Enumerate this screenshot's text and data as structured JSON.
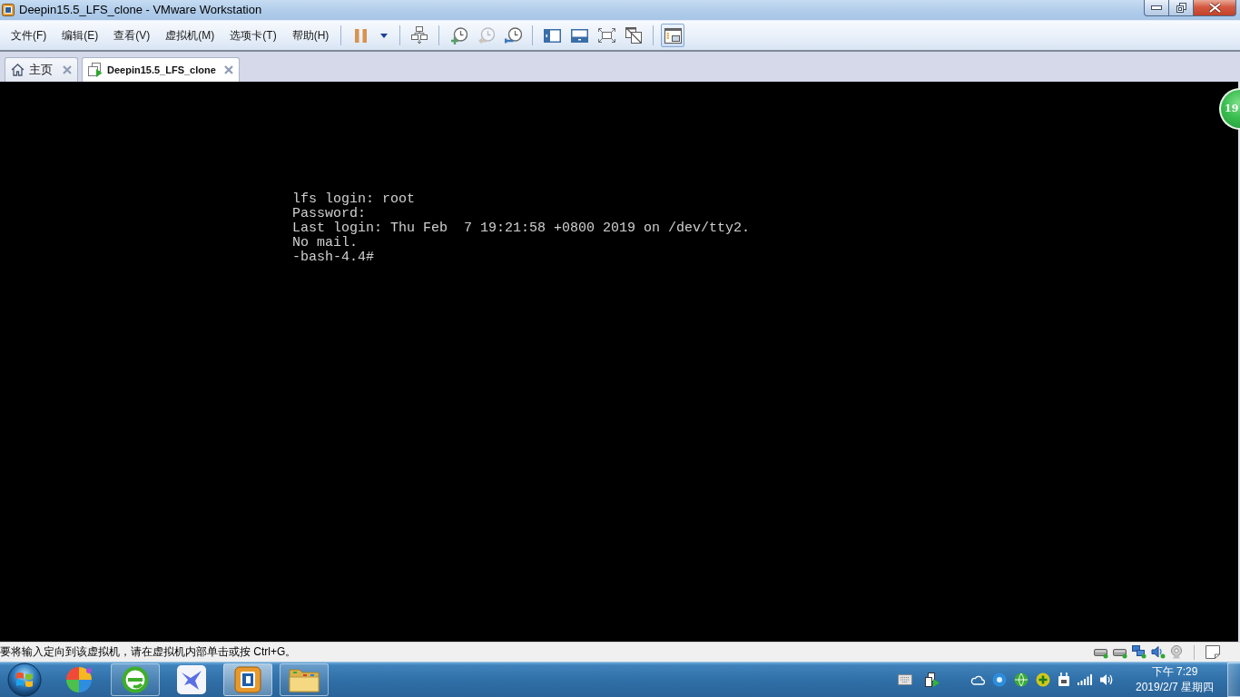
{
  "window": {
    "title": "Deepin15.5_LFS_clone - VMware Workstation"
  },
  "menu": [
    "文件(F)",
    "编辑(E)",
    "查看(V)",
    "虚拟机(M)",
    "选项卡(T)",
    "帮助(H)"
  ],
  "toolbar": {
    "groups": [
      [
        {
          "kind": "pause",
          "disabled": false,
          "selected": false
        },
        {
          "kind": "dropdown",
          "disabled": false,
          "selected": false
        }
      ],
      [
        {
          "kind": "send-keys",
          "disabled": false,
          "selected": false
        }
      ],
      [
        {
          "kind": "snapshot-take",
          "disabled": false,
          "selected": false
        },
        {
          "kind": "snapshot-revert",
          "disabled": true,
          "selected": false
        },
        {
          "kind": "snapshot-manager",
          "disabled": false,
          "selected": false
        }
      ],
      [
        {
          "kind": "console-view",
          "disabled": false,
          "selected": false
        },
        {
          "kind": "thumbnail-bar",
          "disabled": false,
          "selected": false
        },
        {
          "kind": "fullscreen",
          "disabled": false,
          "selected": false
        },
        {
          "kind": "unity",
          "disabled": false,
          "selected": false
        }
      ],
      [
        {
          "kind": "library",
          "disabled": false,
          "selected": true
        }
      ]
    ]
  },
  "tabs": [
    {
      "label": "主页",
      "kind": "home",
      "selected": false
    },
    {
      "label": "Deepin15.5_LFS_clone",
      "kind": "vm",
      "selected": true
    }
  ],
  "console": {
    "lines": [
      "lfs login: root",
      "Password:",
      "Last login: Thu Feb  7 19:21:58 +0800 2019 on /dev/tty2.",
      "No mail.",
      "-bash-4.4#"
    ],
    "floating_ball": "19"
  },
  "status_bar": {
    "message": "要将输入定向到该虚拟机，请在虚拟机内部单击或按 Ctrl+G。"
  },
  "taskbar": {
    "apps": [
      {
        "kind": "pinwheel",
        "running": false,
        "selected": false
      },
      {
        "kind": "browser",
        "running": true,
        "selected": false
      },
      {
        "kind": "bird",
        "running": false,
        "selected": false
      },
      {
        "kind": "vmware",
        "running": true,
        "selected": true
      },
      {
        "kind": "folder",
        "running": true,
        "selected": false
      }
    ],
    "clock": {
      "time": "下午 7:29",
      "date": "2019/2/7 星期四"
    }
  }
}
